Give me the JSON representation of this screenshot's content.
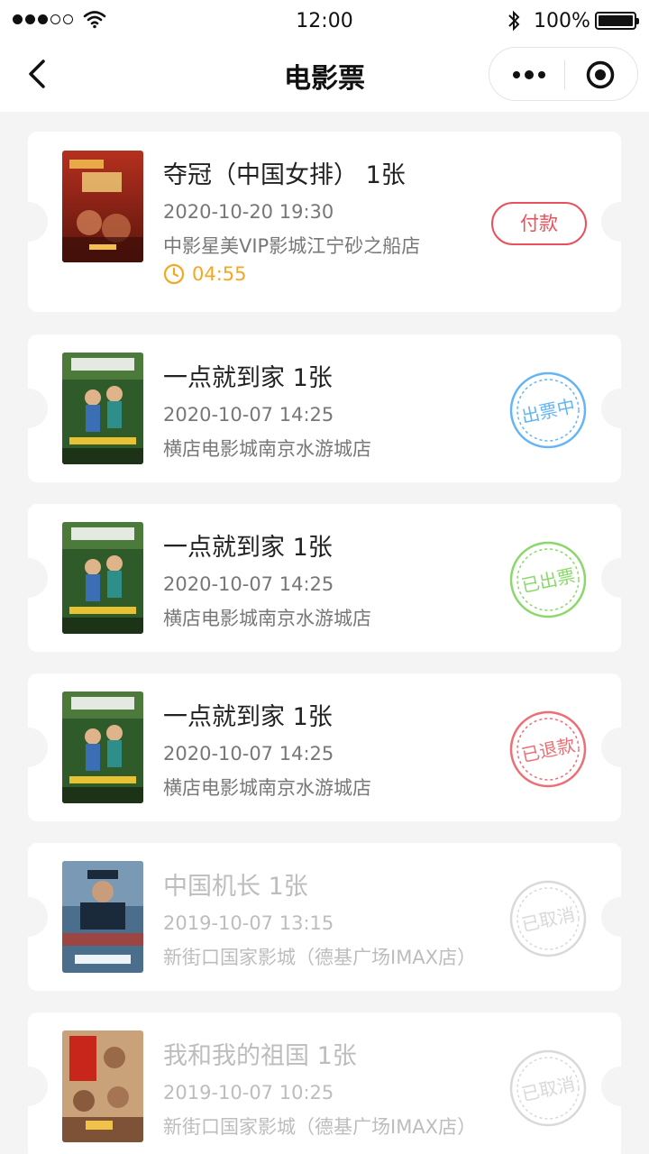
{
  "status_bar": {
    "time": "12:00",
    "battery": "100%"
  },
  "nav": {
    "title": "电影票"
  },
  "colors": {
    "accent_red": "#e8505b",
    "countdown_orange": "#f5a623",
    "stamp_blue": "#64b5f6",
    "stamp_green": "#8bd86a",
    "stamp_red": "#ee6e73",
    "stamp_gray": "#d9d9d9"
  },
  "orders": [
    {
      "name": "夺冠（中国女排） 1张",
      "datetime": "2020-10-20 19:30",
      "cinema": "中影星美VIP影城江宁砂之船店",
      "countdown": "04:55",
      "action_label": "付款"
    },
    {
      "name": "一点就到家 1张",
      "datetime": "2020-10-07 14:25",
      "cinema": "横店电影城南京水游城店",
      "status": "出票中"
    },
    {
      "name": "一点就到家 1张",
      "datetime": "2020-10-07 14:25",
      "cinema": "横店电影城南京水游城店",
      "status": "已出票"
    },
    {
      "name": "一点就到家 1张",
      "datetime": "2020-10-07 14:25",
      "cinema": "横店电影城南京水游城店",
      "status": "已退款"
    },
    {
      "name": "中国机长 1张",
      "datetime": "2019-10-07 13:15",
      "cinema": "新街口国家影城（德基广场IMAX店）",
      "status": "已取消"
    },
    {
      "name": "我和我的祖国 1张",
      "datetime": "2019-10-07 10:25",
      "cinema": "新街口国家影城（德基广场IMAX店）",
      "status": "已取消"
    }
  ]
}
